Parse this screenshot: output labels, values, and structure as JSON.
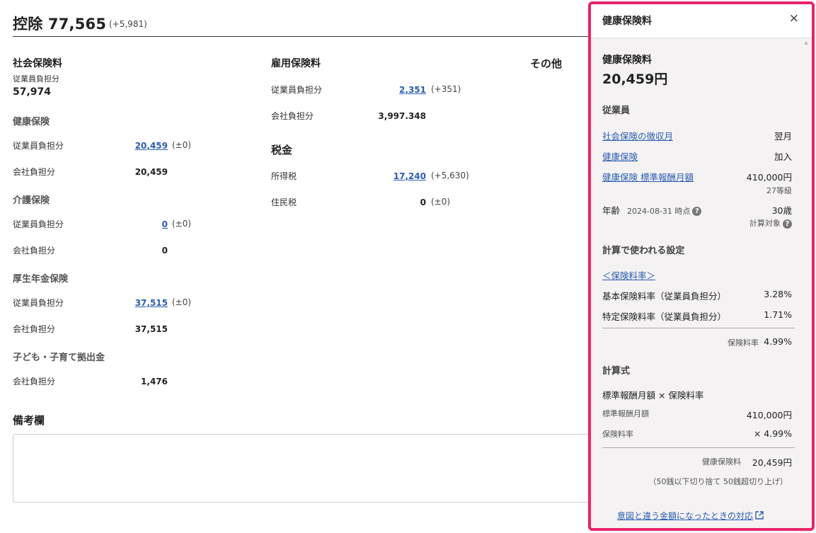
{
  "header": {
    "title": "控除 77,565",
    "diff": "(+5,981)"
  },
  "social": {
    "title": "社会保険料",
    "employee_label": "従業員負担分",
    "employee_total": "57,974",
    "health": {
      "title": "健康保険",
      "emp_label": "従業員負担分",
      "emp_value": "20,459",
      "emp_diff": "(±0)",
      "co_label": "会社負担分",
      "co_value": "20,459"
    },
    "care": {
      "title": "介護保険",
      "emp_label": "従業員負担分",
      "emp_value": "0",
      "emp_diff": "(±0)",
      "co_label": "会社負担分",
      "co_value": "0"
    },
    "pension": {
      "title": "厚生年金保険",
      "emp_label": "従業員負担分",
      "emp_value": "37,515",
      "emp_diff": "(±0)",
      "co_label": "会社負担分",
      "co_value": "37,515"
    },
    "child": {
      "title": "子ども・子育て拠出金",
      "co_label": "会社負担分",
      "co_value": "1,476"
    }
  },
  "employment": {
    "title": "雇用保険料",
    "emp_label": "従業員負担分",
    "emp_value": "2,351",
    "emp_diff": "(+351)",
    "co_label": "会社負担分",
    "co_value": "3,997.348"
  },
  "tax": {
    "title": "税金",
    "income_label": "所得税",
    "income_value": "17,240",
    "income_diff": "(+5,630)",
    "resident_label": "住民税",
    "resident_value": "0",
    "resident_diff": "(±0)"
  },
  "other": {
    "title": "その他"
  },
  "notes": {
    "title": "備考欄",
    "value": ""
  },
  "panel": {
    "header_title": "健康保険料",
    "close": "×",
    "heading": "健康保険料",
    "amount": "20,459円",
    "employee_section": "従業員",
    "rows": [
      {
        "label": "社会保険の徴収月",
        "value": "翌月"
      },
      {
        "label": "健康保険",
        "value": "加入"
      },
      {
        "label": "健康保険 標準報酬月額",
        "value": "410,000円",
        "sub": "27等級"
      }
    ],
    "age": {
      "label": "年齢",
      "date": "2024-08-31 時点",
      "value": "30歳",
      "sub": "計算対象"
    },
    "settings_section": "計算で使われる設定",
    "rate_link": "＜保険料率＞",
    "rates": [
      {
        "label": "基本保険料率（従業員負担分）",
        "value": "3.28%"
      },
      {
        "label": "特定保険料率（従業員負担分）",
        "value": "1.71%"
      }
    ],
    "rate_total_label": "保険料率",
    "rate_total_value": "4.99%",
    "formula_section": "計算式",
    "formula": "標準報酬月額 × 保険料率",
    "formula_rows": [
      {
        "label": "標準報酬月額",
        "value": "410,000円"
      },
      {
        "label": "保険料率",
        "value": "× 4.99%"
      }
    ],
    "result_label": "健康保険料",
    "result_value": "20,459円",
    "rounding_note": "（50銭以下切り捨て 50銭超切り上げ）",
    "help_link": "意図と違う金額になったときの対応"
  }
}
